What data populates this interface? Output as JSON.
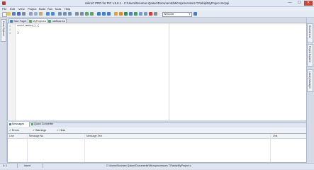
{
  "window": {
    "title": "mikroC PRO for PIC v.5.6.1 - C:\\Users\\Nouman Qaiser\\Documents\\Microprocessors T.Rahip\\MyProject.mcppi",
    "minimize": "—",
    "maximize": "☐",
    "close": "✕"
  },
  "menu": [
    "File",
    "Edit",
    "View",
    "Project",
    "Build",
    "Run",
    "Tools",
    "Help"
  ],
  "toolbar": {
    "combo_value": "WinCode",
    "icons": [
      "new-file-icon",
      "open-icon",
      "save-icon",
      "save-all-icon",
      "print-icon",
      "cut-icon",
      "copy-icon",
      "paste-icon",
      "undo-icon",
      "redo-icon",
      "find-icon",
      "find-next-icon",
      "replace-icon",
      "indent-icon",
      "outdent-icon",
      "comment-icon",
      "uncomment-icon",
      "bookmark-icon",
      "prev-bookmark-icon",
      "next-bookmark-icon",
      "build-icon",
      "build-all-icon",
      "program-icon",
      "debug-icon",
      "run-icon",
      "step-into-icon",
      "step-over-icon",
      "stop-icon",
      "options-icon",
      "help-icon"
    ]
  },
  "left_panel": {
    "tab_label": "Code Explorer"
  },
  "right_panel": {
    "tabs": [
      "Routine List",
      "Project Explorer",
      "Library Manager"
    ]
  },
  "editor": {
    "tabs": [
      {
        "label": "Start Page",
        "close": "✕"
      },
      {
        "label": "MyProject.c",
        "close": "✕"
      },
      {
        "label": "LabBoard.c",
        "close": "✕"
      }
    ],
    "lines": [
      {
        "number": "1",
        "text": "void main() {"
      },
      {
        "number": "2",
        "text": ""
      },
      {
        "number": "3",
        "text": "}"
      }
    ]
  },
  "messages": {
    "tabs": [
      "Messages",
      "Quick Converter"
    ],
    "filters": [
      {
        "label": "Errors",
        "checked": true
      },
      {
        "label": "Warnings",
        "checked": true
      },
      {
        "label": "Hints",
        "checked": true
      }
    ],
    "columns": [
      "Line",
      "Message No.",
      "Message Text",
      "Unit"
    ]
  },
  "status": {
    "position": "3: 1",
    "mode": "Insert",
    "file": "C:\\Users\\Nouman Qaiser\\Documents\\Microprocessors T.Rahip\\MyProject.c"
  },
  "colors": {
    "chrome": "#d4dbe7",
    "close_button": "#c8463c",
    "accent": "#4a7fc1"
  }
}
